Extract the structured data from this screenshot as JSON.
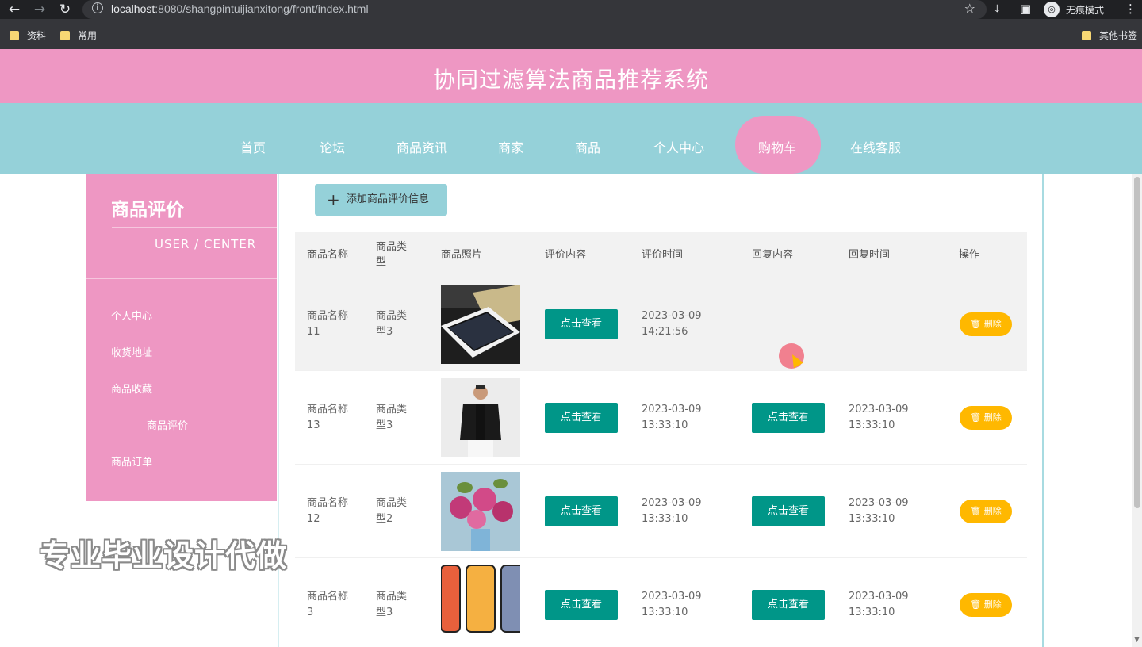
{
  "browser": {
    "url_host": "localhost",
    "url_rest": ":8080/shangpintuijianxitong/front/index.html",
    "incognito_label": "无痕模式",
    "bookmarks": [
      "资料",
      "常用"
    ],
    "other_bookmarks": "其他书签"
  },
  "site": {
    "title": "协同过滤算法商品推荐系统",
    "nav": [
      "首页",
      "论坛",
      "商品资讯",
      "商家",
      "商品",
      "个人中心",
      "购物车",
      "在线客服"
    ],
    "active_nav": "购物车"
  },
  "sidebar": {
    "title": "商品评价",
    "subtitle": "USER / CENTER",
    "items": [
      "个人中心",
      "收货地址",
      "商品收藏",
      "商品评价",
      "商品订单"
    ]
  },
  "main": {
    "add_button": "添加商品评价信息",
    "columns": [
      "商品名称",
      "商品类型",
      "商品照片",
      "评价内容",
      "评价时间",
      "回复内容",
      "回复时间",
      "操作"
    ],
    "view_label": "点击查看",
    "delete_label": "删除",
    "rows": [
      {
        "name_a": "商品名称",
        "name_b": "11",
        "type_a": "商品类",
        "type_b": "型3",
        "time_a": "2023-03-09",
        "time_b": "14:21:56",
        "reply_time_a": "",
        "reply_time_b": "",
        "image": "phone-silver"
      },
      {
        "name_a": "商品名称",
        "name_b": "13",
        "type_a": "商品类",
        "type_b": "型3",
        "time_a": "2023-03-09",
        "time_b": "13:33:10",
        "reply_time_a": "2023-03-09",
        "reply_time_b": "13:33:10",
        "image": "man-jacket"
      },
      {
        "name_a": "商品名称",
        "name_b": "12",
        "type_a": "商品类",
        "type_b": "型2",
        "time_a": "2023-03-09",
        "time_b": "13:33:10",
        "reply_time_a": "2023-03-09",
        "reply_time_b": "13:33:10",
        "image": "lily-flowers"
      },
      {
        "name_a": "商品名称",
        "name_b": "3",
        "type_a": "商品类",
        "type_b": "型3",
        "time_a": "2023-03-09",
        "time_b": "13:33:10",
        "reply_time_a": "2023-03-09",
        "reply_time_b": "13:33:10",
        "image": "colorful-phones"
      }
    ]
  },
  "watermark": "专业毕业设计代做"
}
